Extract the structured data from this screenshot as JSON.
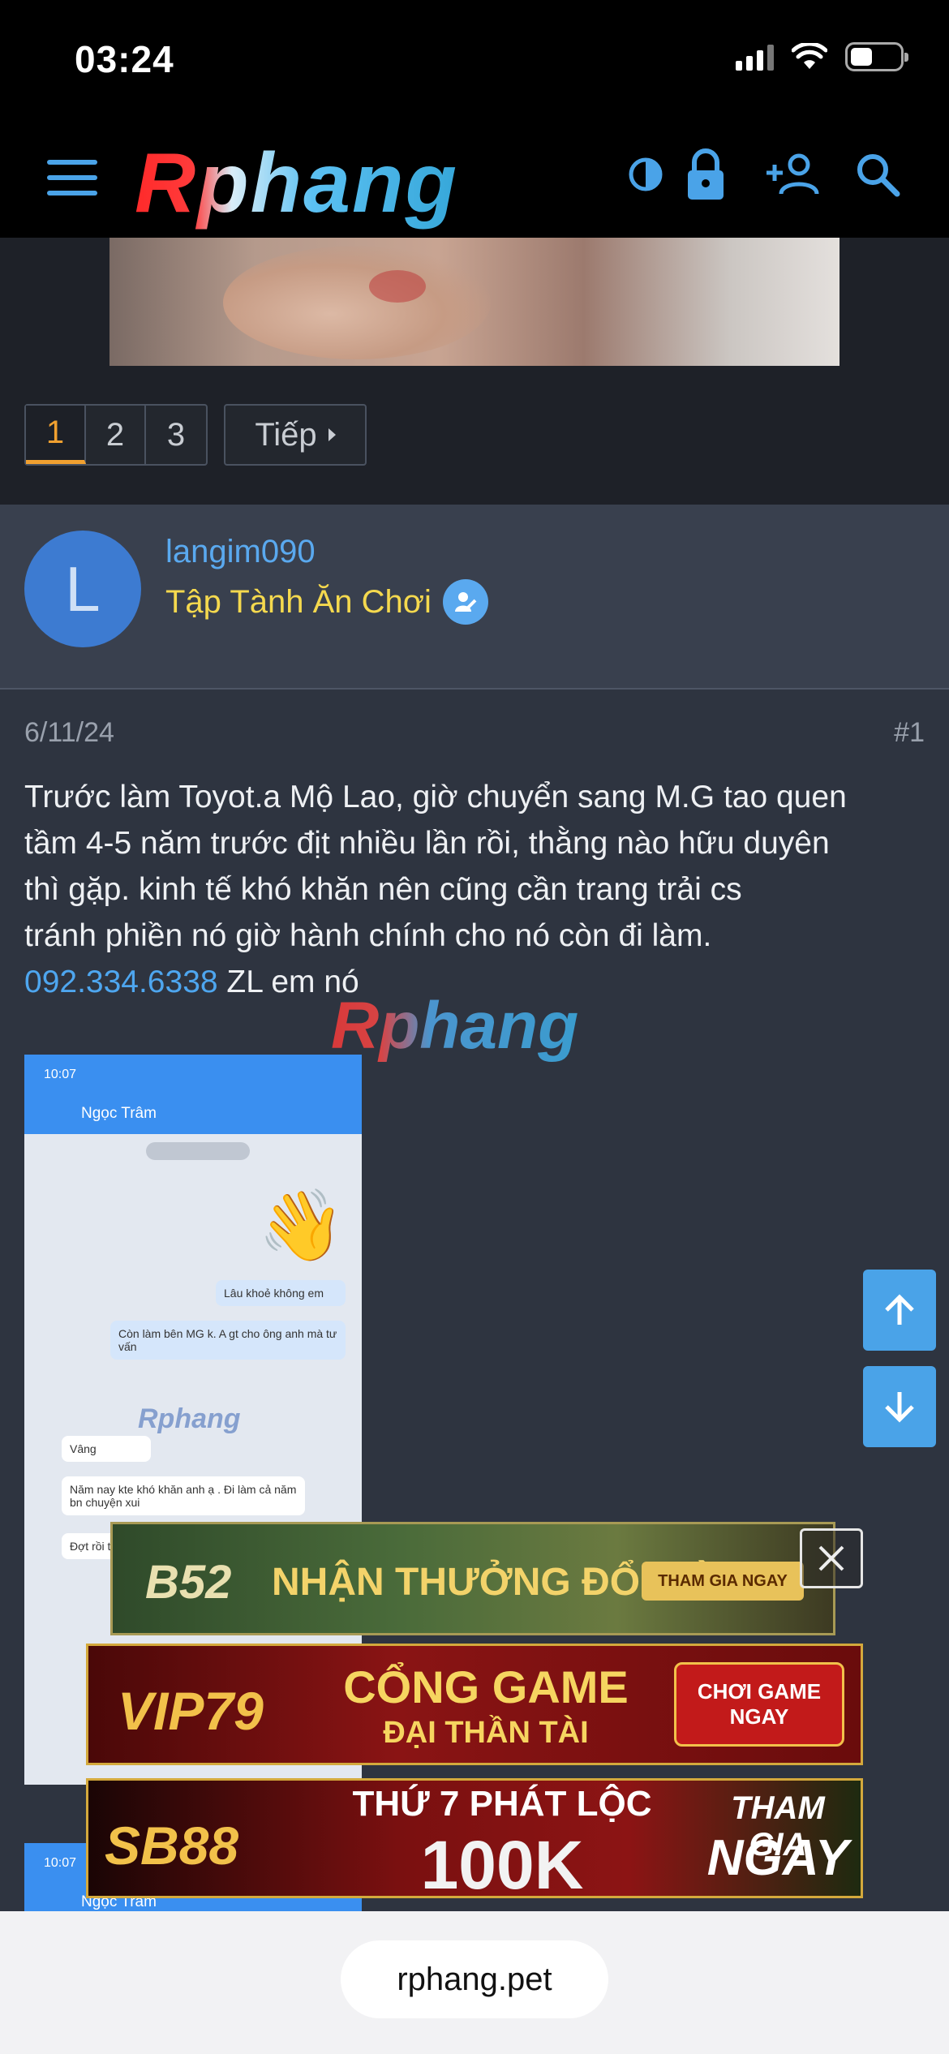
{
  "status_bar": {
    "time": "03:24"
  },
  "header": {
    "logo": "Rphang"
  },
  "pagination": {
    "pages": [
      "1",
      "2",
      "3"
    ],
    "active": "1",
    "next_label": "Tiếp"
  },
  "author": {
    "avatar_letter": "L",
    "username": "langim090",
    "user_title": "Tập Tành Ăn Chơi"
  },
  "post": {
    "date": "6/11/24",
    "number": "#1",
    "lines": [
      "Trước làm Toyot.a Mộ Lao, giờ chuyển sang M.G tao quen",
      "tầm 4-5 năm trước địt nhiều lần rồi, thằng nào hữu duyên",
      "thì gặp. kinh tế khó khăn nên cũng cần trang trải cs",
      "tránh phiền nó giờ hành chính cho nó còn đi làm."
    ],
    "phone": "092.334.6338",
    "phone_suffix": " ZL em nó"
  },
  "watermark": "Rphang",
  "chat_image": {
    "time": "10:07",
    "contact": "Ngọc Trâm",
    "messages": [
      "Lâu khoẻ không em",
      "Còn làm bên MG k. A gt cho ông anh mà tư vấn",
      "Vâng",
      "Năm nay kte khó khăn anh ạ . Đi làm cả năm bn chuyện xui",
      "Đợt rồi tiền nợ"
    ],
    "watermark": "Rphang"
  },
  "chat_image_2": {
    "time": "10:07",
    "contact": "Ngọc Trâm"
  },
  "ads": {
    "b52": {
      "brand": "B52",
      "text": "NHẬN THƯỞNG ĐỔI ĐỜI",
      "cta": "THAM GIA NGAY"
    },
    "vip79": {
      "brand": "VIP79",
      "text1": "CỔNG GAME",
      "text2": "ĐẠI THẦN TÀI",
      "cta": "CHƠI GAME NGAY"
    },
    "sb88": {
      "brand": "SB88",
      "text1": "THỨ 7 PHÁT LỘC",
      "text2": "100K",
      "cta1": "THAM GIA",
      "cta2": "NGAY"
    }
  },
  "browser": {
    "url": "rphang.pet"
  },
  "colors": {
    "accent": "#4aa3e8",
    "username": "#5aa9ef",
    "user_title": "#f5d94e",
    "active_page": "#f0a030"
  }
}
